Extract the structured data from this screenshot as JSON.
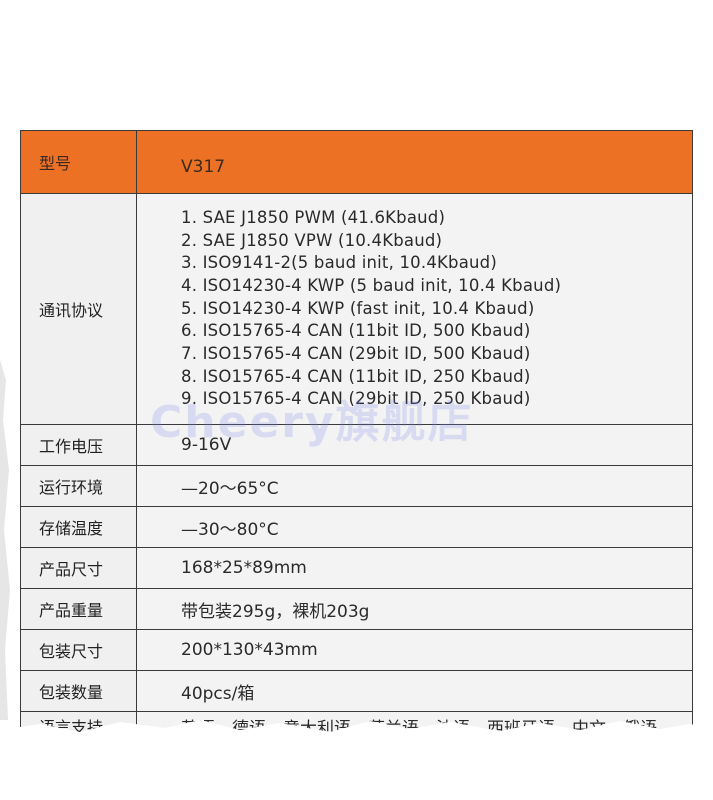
{
  "table": {
    "header": {
      "label": "型号",
      "value": "V317"
    },
    "protocol": {
      "label": "通讯协议",
      "items": [
        "1.  SAE J1850 PWM (41.6Kbaud)",
        "2.  SAE J1850 VPW (10.4Kbaud)",
        "3.  ISO9141-2(5 baud init, 10.4Kbaud)",
        "4.  ISO14230-4 KWP (5 baud init, 10.4 Kbaud)",
        "5.  ISO14230-4 KWP (fast init, 10.4 Kbaud)",
        "6.  ISO15765-4 CAN (11bit ID, 500 Kbaud)",
        "7.  ISO15765-4 CAN (29bit ID, 500 Kbaud)",
        "8.  ISO15765-4 CAN (11bit ID, 250 Kbaud)",
        "9.  ISO15765-4 CAN (29bit ID, 250 Kbaud)"
      ]
    },
    "rows": [
      {
        "label": "工作电压",
        "value": "9-16V"
      },
      {
        "label": "运行环境",
        "value": "—20～65°C"
      },
      {
        "label": "存储温度",
        "value": "—30～80°C"
      },
      {
        "label": "产品尺寸",
        "value": "168*25*89mm"
      },
      {
        "label": "产品重量",
        "value": "带包装295g，裸机203g"
      },
      {
        "label": "包装尺寸",
        "value": "200*130*43mm"
      },
      {
        "label": "包装数量",
        "value": "40pcs/箱"
      }
    ],
    "language": {
      "label": "语言支持",
      "value": "英语、德语、意大利语、荷兰语、法语、西班牙语、中文、俄语"
    }
  },
  "watermark": "Cheery旗舰店",
  "colors": {
    "header_bg": "#ec7125",
    "cell_bg": "#f2f2f2",
    "border": "#3a3a3a",
    "watermark": "#7882e6"
  }
}
